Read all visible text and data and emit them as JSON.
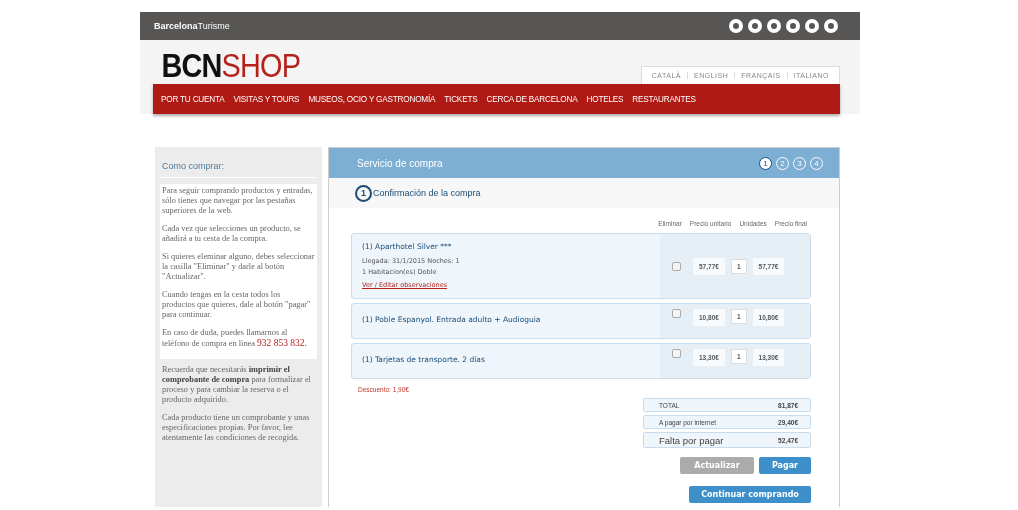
{
  "topbar": {
    "logo": "**Barcelona**Turisme"
  },
  "header": {
    "brand": {
      "dark": "BCN",
      "accent": "SHOP"
    },
    "languages": [
      "CATALÀ",
      "ENGLISH",
      "FRANÇAIS",
      "ITALIANO"
    ]
  },
  "nav": [
    "POR TU CUENTA",
    "VISITAS Y TOURS",
    "MUSEOS, OCIO Y GASTRONOMÍA",
    "TICKETS",
    "CERCA DE BARCELONA",
    "HOTELES",
    "RESTAURANTES"
  ],
  "sidebar": {
    "title": "Como comprar:",
    "box": [
      {
        "text": "Para seguir comprando productos y entradas, sólo tienes que navegar por las pestañas superiores de la web."
      },
      {
        "text": "Cada vez que selecciones un producto, se añadirá a tu cesta de la compra."
      },
      {
        "text": "Si quieres eleminar alguno, debes seleccionar la casilla \"Eliminar\" y darle al botón \"Actualizar\"."
      },
      {
        "text": "Cuando tengas en la cesta todos los productos que quieres, dale al botón \"pagar\" para continuar."
      },
      {
        "text": "En caso de duda, puedes llamarnos al teléfono de compra en linea",
        "phone": "932 853 832."
      }
    ],
    "notes": [
      "Recuerda que necesitarás **imprimir el comprobante de compra** para formalizar el proceso y para cambiar la reserva o el producto adquirido.",
      "Cada producto tiene un comprobante y unas especificaciones propias. Por favor, lee atentamente las condiciones de recogida."
    ]
  },
  "panel": {
    "title": "Servicio de compra",
    "steps": [
      {
        "label": "1",
        "selected": true
      },
      {
        "label": "2",
        "selected": false
      },
      {
        "label": "3",
        "selected": false
      },
      {
        "label": "4",
        "selected": false
      }
    ],
    "step_heading": {
      "number": "1",
      "text": "Confirmación de la compra"
    },
    "columns": [
      "Eliminar",
      "Precio unitario",
      "Unidades",
      "Precio final"
    ],
    "items": [
      {
        "name": "(1) Aparthotel Silver ***",
        "details": [
          "Llegada: 31/1/2015 Noches: 1",
          "1 Habitacion(es) Doble"
        ],
        "link": "Ver / Editar observaciones",
        "checked": false,
        "unit_price": "57,77€",
        "quantity": "1",
        "final_price": "57,77€"
      },
      {
        "name": "(1) Poble Espanyol. Entrada adulto + Audioguia",
        "checked": false,
        "unit_price": "10,80€",
        "quantity": "1",
        "final_price": "10,80€"
      },
      {
        "name": "(1) Tarjetas de transporte. 2 días",
        "checked": false,
        "unit_price": "13,30€",
        "quantity": "1",
        "final_price": "13,30€"
      }
    ],
    "discount": "Descuento: 1,90€",
    "totals": [
      {
        "kind": "normal",
        "label": "TOTAL",
        "value": "81,87€"
      },
      {
        "kind": "normal",
        "label": "A pagar por internet",
        "value": "29,40€"
      },
      {
        "kind": "large",
        "label": "Falta por pagar",
        "value": "52,47€"
      }
    ],
    "buttons": [
      {
        "kind": "secondary",
        "label": "Actualizar"
      },
      {
        "kind": "primary",
        "label": "Pagar"
      }
    ],
    "continue_button": "Continuar comprando"
  }
}
